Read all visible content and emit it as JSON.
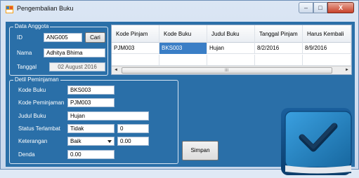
{
  "window": {
    "title": "Pengembalian Buku",
    "controls": {
      "minimize": "–",
      "maximize": "□",
      "close": "X"
    }
  },
  "data_anggota": {
    "title": "Data Anggota",
    "id_label": "ID",
    "id_value": "ANG005",
    "cari_label": "Cari",
    "nama_label": "Nama",
    "nama_value": "Adhitya Bhima",
    "tanggal_label": "Tanggal",
    "tanggal_value": "02 August 2016"
  },
  "grid": {
    "columns": [
      "Kode Pinjam",
      "Kode Buku",
      "Judul Buku",
      "Tanggal Pinjam",
      "Harus Kembali"
    ],
    "rows": [
      [
        "PJM003",
        "BKS003",
        "Hujan",
        "8/2/2016",
        "8/9/2016"
      ]
    ],
    "scroll_grip": "III",
    "scroll_left": "◄",
    "scroll_right": "►"
  },
  "detil": {
    "title": "Detil Peminjaman",
    "kode_buku_label": "Kode Buku",
    "kode_buku_value": "BKS003",
    "kode_peminjaman_label": "Kode Peminjaman",
    "kode_peminjaman_value": "PJM003",
    "judul_buku_label": "Judul Buku",
    "judul_buku_value": "Hujan",
    "status_label": "Status Terlambat",
    "status_value": "Tidak",
    "status_days": "0",
    "keterangan_label": "Keterangan",
    "keterangan_value": "Baik",
    "keterangan_amount": "0.00",
    "denda_label": "Denda",
    "denda_value": "0.00"
  },
  "simpan_label": "Simpan",
  "colors": {
    "panel": "#2a6fa8",
    "selection": "#3a7ec6",
    "close": "#c8412a"
  },
  "icons": [
    "app-icon",
    "checkmark-book-icon"
  ]
}
